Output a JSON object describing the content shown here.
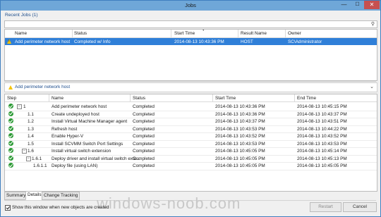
{
  "window": {
    "title": "Jobs",
    "minimize_glyph": "—",
    "maximize_glyph": "☐",
    "close_glyph": "✕"
  },
  "recent_jobs": {
    "label": "Recent Jobs (1)",
    "search_placeholder": "",
    "columns": [
      "Name",
      "Status",
      "Start Time",
      "Result Name",
      "Owner"
    ],
    "rows": [
      {
        "icon": "warning-icon",
        "name": "Add perimeter network host",
        "status": "Completed w/ Info",
        "start_time": "2014-08-13 10:43:36 PM",
        "result_name": "HOST",
        "owner": "SC\\Administrator",
        "selected": true
      }
    ]
  },
  "detail": {
    "title": "Add perimeter network host"
  },
  "steps": {
    "columns": [
      "Step",
      "Name",
      "Status",
      "Start Time",
      "End Time"
    ],
    "rows": [
      {
        "step": "1",
        "expander": "⊟",
        "name": "Add perimeter network host",
        "status": "Completed",
        "start": "2014-08-13 10:43:36 PM",
        "end": "2014-08-13 10:45:15 PM"
      },
      {
        "step": "1.1",
        "expander": "",
        "name": "Create undeployed host",
        "status": "Completed",
        "start": "2014-08-13 10:43:36 PM",
        "end": "2014-08-13 10:43:37 PM"
      },
      {
        "step": "1.2",
        "expander": "",
        "name": "Install Virtual Machine Manager agent",
        "status": "Completed",
        "start": "2014-08-13 10:43:37 PM",
        "end": "2014-08-13 10:43:51 PM"
      },
      {
        "step": "1.3",
        "expander": "",
        "name": "Refresh host",
        "status": "Completed",
        "start": "2014-08-13 10:43:53 PM",
        "end": "2014-08-13 10:44:22 PM"
      },
      {
        "step": "1.4",
        "expander": "",
        "name": "Enable Hyper-V",
        "status": "Completed",
        "start": "2014-08-13 10:43:52 PM",
        "end": "2014-08-13 10:43:52 PM"
      },
      {
        "step": "1.5",
        "expander": "",
        "name": "Install SCVMM Switch Port Settings",
        "status": "Completed",
        "start": "2014-08-13 10:43:53 PM",
        "end": "2014-08-13 10:43:53 PM"
      },
      {
        "step": "1.6",
        "expander": "⊟",
        "name": "Install virtual switch extension",
        "status": "Completed",
        "start": "2014-08-13 10:45:05 PM",
        "end": "2014-08-13 10:45:14 PM"
      },
      {
        "step": "1.6.1",
        "expander": "⊟",
        "name": "Deploy driver and install virtual switch exte...",
        "status": "Completed",
        "start": "2014-08-13 10:45:05 PM",
        "end": "2014-08-13 10:45:13 PM"
      },
      {
        "step": "1.6.1.1",
        "expander": "",
        "name": "Deploy file (using LAN)",
        "status": "Completed",
        "start": "2014-08-13 10:45:05 PM",
        "end": "2014-08-13 10:45:05 PM"
      }
    ]
  },
  "tabs": [
    {
      "label": "Summary",
      "active": false
    },
    {
      "label": "Details",
      "active": true
    },
    {
      "label": "Change Tracking",
      "active": false
    }
  ],
  "footer": {
    "checkbox_label": "Show this window when new objects are created",
    "checkbox_checked": true,
    "restart_label": "Restart",
    "cancel_label": "Cancel"
  },
  "watermark": "windows-noob.com"
}
